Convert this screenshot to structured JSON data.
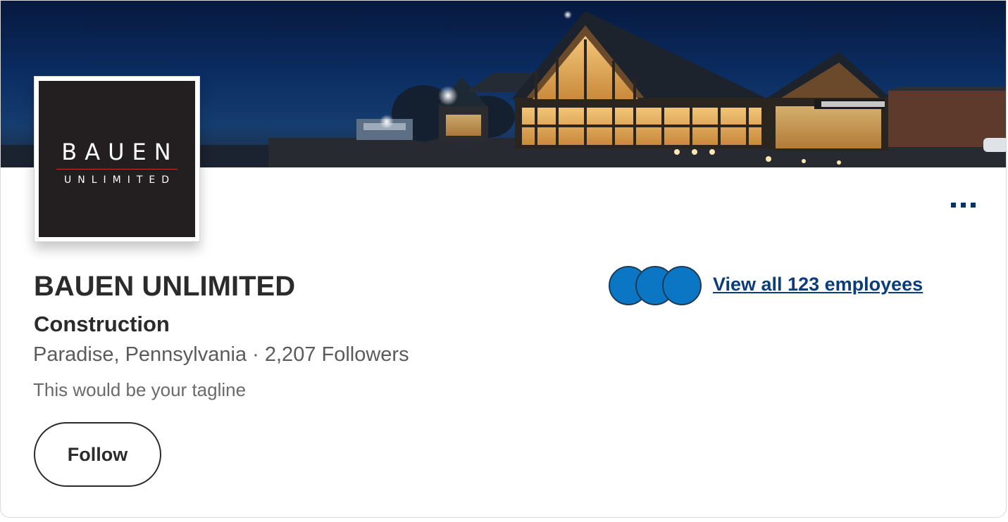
{
  "company": {
    "name": "BAUEN UNLIMITED",
    "industry": "Construction",
    "location": "Paradise, Pennsylvania",
    "separator": "·",
    "followers": "2,207 Followers",
    "tagline": "This would be your tagline"
  },
  "logo": {
    "word": "BAUEN",
    "sub": "UNLIMITED"
  },
  "actions": {
    "follow_label": "Follow",
    "view_employees_label": "View all 123 employees",
    "more_icon": "more-horizontal-icon"
  },
  "colors": {
    "accent": "#0a3d7a",
    "avatar": "#0a76c4",
    "logo_bg": "#231f20",
    "logo_rule": "#c5362e"
  }
}
